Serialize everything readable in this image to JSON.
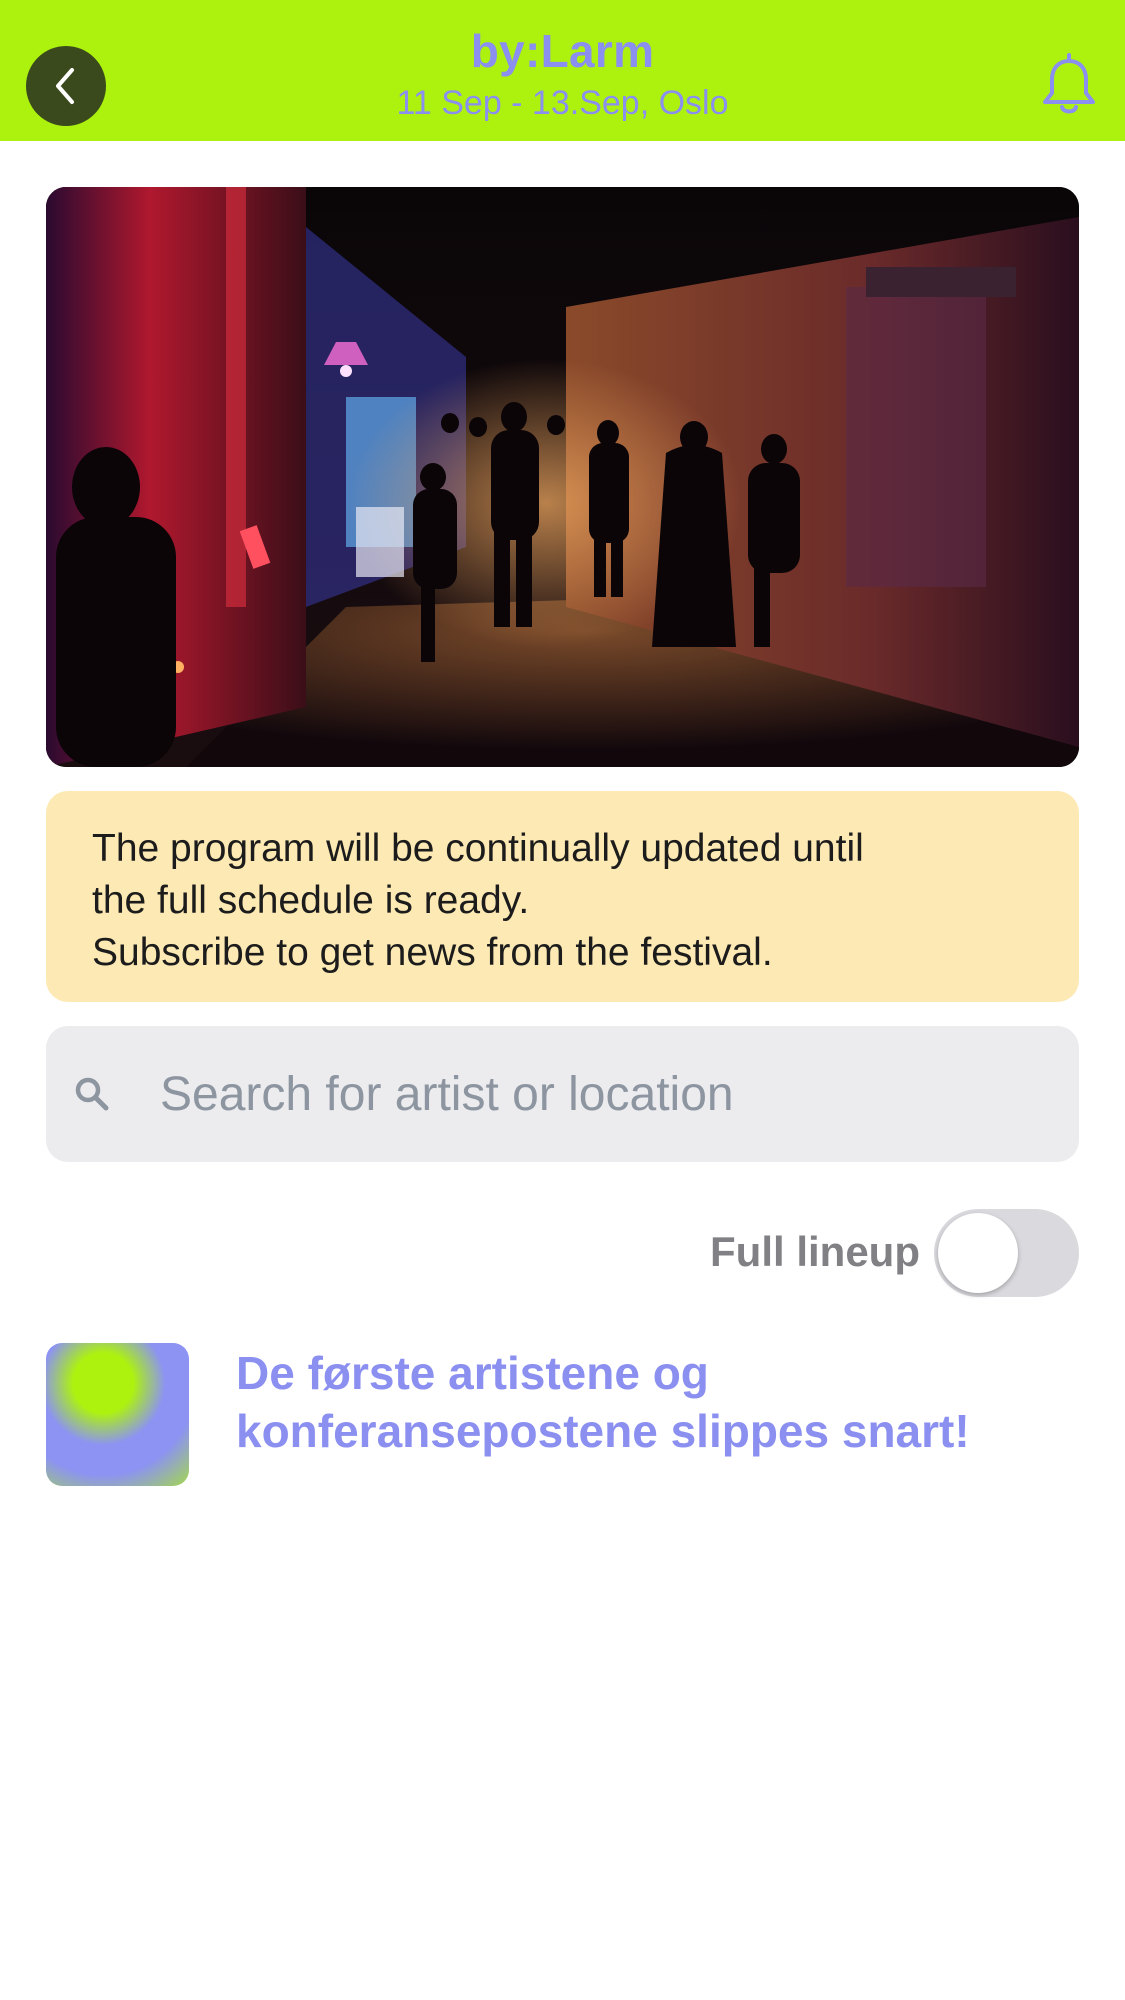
{
  "header": {
    "title": "by:Larm",
    "subtitle": "11 Sep - 13.Sep, Oslo",
    "back_icon": "chevron-left-icon",
    "notify_icon": "bell-icon"
  },
  "hero": {
    "image": "festival-night-street-photo"
  },
  "notice": {
    "line1": "The program will be continually updated until",
    "line2": "the full schedule is ready.",
    "line3": "Subscribe to get news from the festival."
  },
  "search": {
    "placeholder": "Search for artist or location",
    "value": "",
    "icon": "search-icon"
  },
  "lineup_toggle": {
    "label": "Full lineup",
    "on": false
  },
  "announcement": {
    "line1": "De første artistene og",
    "line2": "konferansepostene slippes snart!"
  },
  "colors": {
    "accent_green": "#adf20f",
    "accent_purple": "#8a8ff0",
    "notice_bg": "#fde9b3",
    "search_bg": "#ececef"
  }
}
